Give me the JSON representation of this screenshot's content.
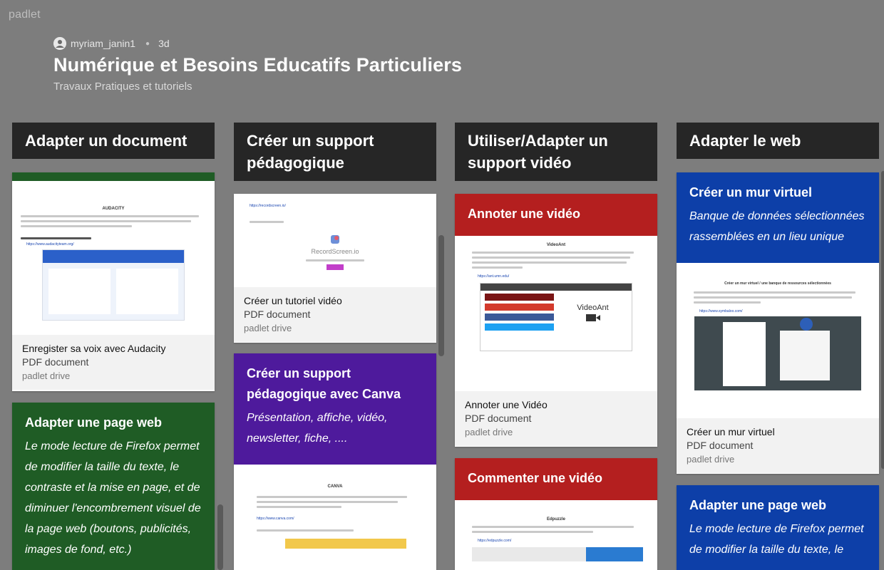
{
  "app": {
    "brand": "padlet"
  },
  "header": {
    "author": "myriam_janin1",
    "age": "3d",
    "title": "Numérique et Besoins Educatifs Particuliers",
    "subtitle": "Travaux Pratiques et tutoriels"
  },
  "colors": {
    "background": "#7d7d7d",
    "column_header": "#262626",
    "green": "#1f5c25",
    "purple": "#4e1a9c",
    "red": "#b41f1f",
    "blue": "#0d3fa8"
  },
  "columns": [
    {
      "title": "Adapter un document",
      "cards": [
        {
          "preview_heading": "AUDACITY",
          "preview_link": "https://www.audacityteam.org/",
          "attachment": {
            "name": "Enregister sa voix avec Audacity",
            "type": "PDF document",
            "source": "padlet drive"
          }
        },
        {
          "title": "Adapter une page web",
          "body": "Le mode lecture de Firefox permet de modifier la taille du texte, le contraste et la mise en page, et de diminuer  l'encombrement visuel de la page web (boutons, publicités, images de fond, etc.)"
        }
      ]
    },
    {
      "title": "Créer un support pédagogique",
      "cards": [
        {
          "preview_link": "https://recordscreen.io/",
          "preview_brand": "RecordScreen.io",
          "attachment": {
            "name": "Créer un tutoriel vidéo",
            "type": "PDF document",
            "source": "padlet drive"
          }
        },
        {
          "title": "Créer un support pédagogique avec Canva",
          "body": "Présentation, affiche, vidéo, newsletter, fiche, ....",
          "preview_heading": "CANVA",
          "preview_link": "https://www.canva.com/"
        }
      ]
    },
    {
      "title": "Utiliser/Adapter un support vidéo",
      "cards": [
        {
          "title": "Annoter une vidéo",
          "preview_heading": "VideoAnt",
          "preview_link": "https://ant.umn.edu/",
          "preview_brand": "VideoAnt",
          "attachment": {
            "name": "Annoter une Vidéo",
            "type": "PDF document",
            "source": "padlet drive"
          }
        },
        {
          "title": "Commenter une vidéo",
          "preview_heading": "Edpuzzle",
          "preview_link": "https://edpuzzle.com/"
        }
      ]
    },
    {
      "title": "Adapter le web",
      "cards": [
        {
          "title": "Créer un mur virtuel",
          "body": "Banque de données sélectionnées rassemblées en un lieu unique",
          "preview_heading": "Créer un mur virtuel / une banque de ressources sélectionnées",
          "preview_link": "https://www.symbaloo.com/",
          "attachment": {
            "name": "Créer un mur virtuel",
            "type": "PDF document",
            "source": "padlet drive"
          }
        },
        {
          "title": "Adapter une page web",
          "body": "Le mode lecture de Firefox permet de modifier la taille du texte, le"
        }
      ]
    }
  ]
}
